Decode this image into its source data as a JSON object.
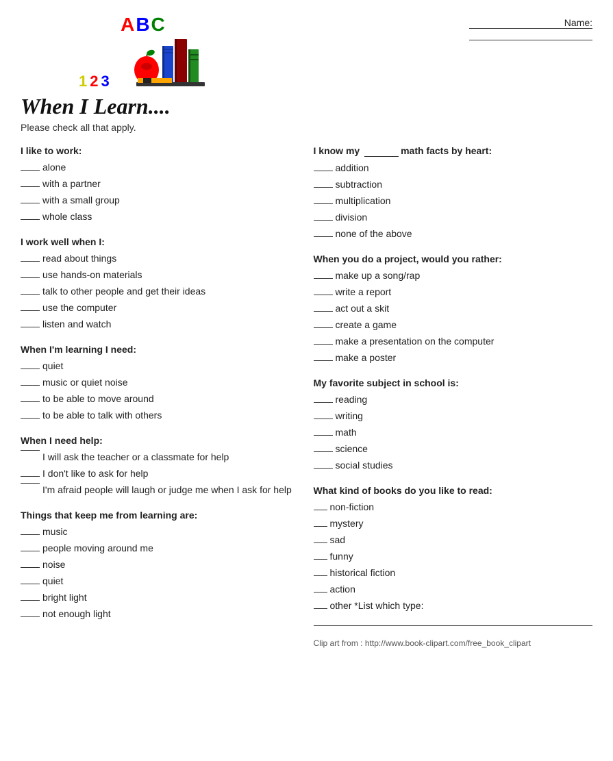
{
  "header": {
    "name_label": "Name:",
    "abc": "ABC",
    "nums": "123"
  },
  "title": "When I Learn....",
  "subtitle": "Please check all that apply.",
  "left": {
    "section1": {
      "title": "I like to work:",
      "items": [
        "alone",
        "with a partner",
        "with a small group",
        "whole class"
      ]
    },
    "section2": {
      "title": "I work well when I:",
      "items": [
        "read about things",
        "use hands-on materials",
        "talk to other people and get their ideas",
        "use the computer",
        "listen and watch"
      ]
    },
    "section3": {
      "title": "When I'm learning I need:",
      "items": [
        "quiet",
        "music or quiet noise",
        "to be able to move around",
        "to be able to talk with others"
      ]
    },
    "section4": {
      "title": "When I need help:",
      "items": [
        "I will ask the teacher or a classmate for help",
        "I don't like to ask for help",
        "I'm afraid people will laugh or judge me when I ask for help"
      ]
    },
    "section5": {
      "title": "Things that keep me from learning are:",
      "items": [
        "music",
        "people moving around me",
        "noise",
        "quiet",
        "bright light",
        "not enough light"
      ]
    }
  },
  "right": {
    "section1": {
      "title": "I know my",
      "title2": "math facts by heart:",
      "items": [
        "addition",
        "subtraction",
        "multiplication",
        "division",
        "none of the above"
      ]
    },
    "section2": {
      "title": "When you do a project, would you rather:",
      "items": [
        "make up a song/rap",
        "write a report",
        "act out a skit",
        "create a game",
        "make a presentation on the computer",
        "make a poster"
      ]
    },
    "section3": {
      "title": "My favorite subject in school is:",
      "items": [
        "reading",
        "writing",
        "math",
        "science",
        "social studies"
      ]
    },
    "section4": {
      "title": "What kind of books do you like to read:",
      "items": [
        "non-fiction",
        "mystery",
        "sad",
        "funny",
        "historical fiction",
        "action",
        "other  *List which type:"
      ]
    },
    "clip_art": "Clip art from :  http://www.book-clipart.com/free_book_clipart"
  }
}
